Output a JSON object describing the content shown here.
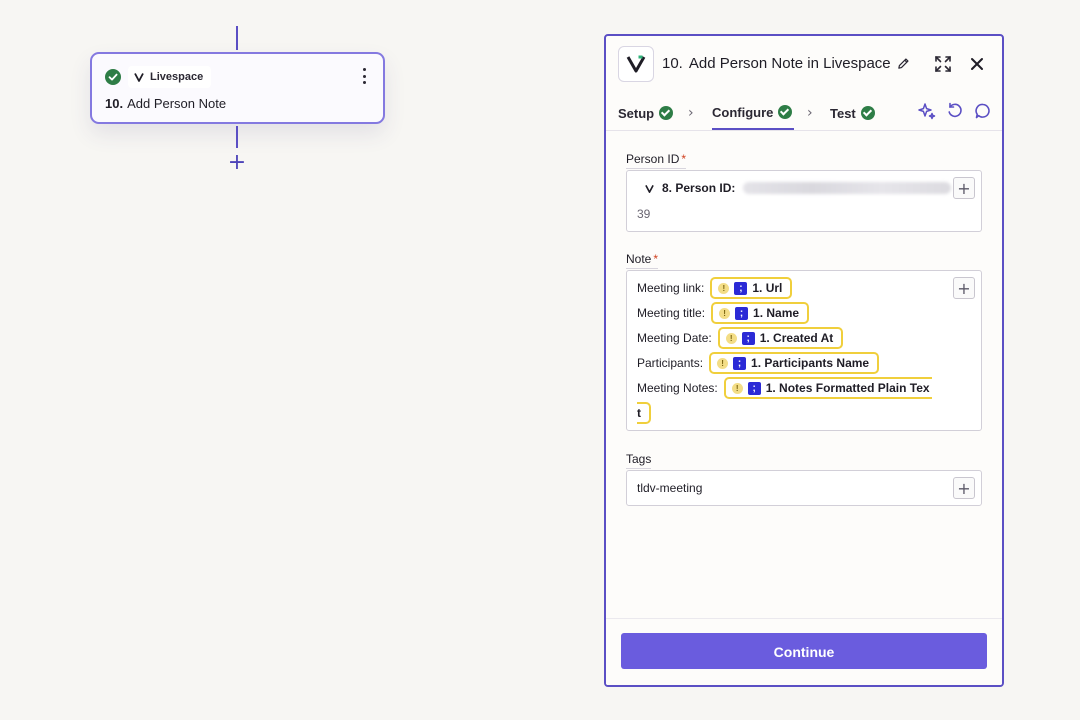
{
  "canvas": {
    "node": {
      "app_name": "Livespace",
      "step_number": "10.",
      "step_title": "Add Person Note"
    },
    "add_step_symbol": "+"
  },
  "panel": {
    "title_number": "10.",
    "title_text": "Add Person Note in Livespace",
    "tabs": [
      {
        "label": "Setup",
        "status": "complete"
      },
      {
        "label": "Configure",
        "status": "complete",
        "active": true
      },
      {
        "label": "Test",
        "status": "complete"
      }
    ],
    "fields": {
      "person_id": {
        "label": "Person ID",
        "required_mark": "*",
        "token_label": "8. Person ID:",
        "extra_value": "39"
      },
      "note": {
        "label": "Note",
        "required_mark": "*",
        "lines": [
          {
            "prefix": "Meeting link:",
            "token": "1. Url"
          },
          {
            "prefix": "Meeting title:",
            "token": "1. Name"
          },
          {
            "prefix": "Meeting Date:",
            "token": "1. Created At"
          },
          {
            "prefix": "Participants:",
            "token": "1. Participants Name"
          },
          {
            "prefix": "Meeting Notes:",
            "token": "1. Notes Formatted Plain Tex"
          }
        ],
        "wrap_tail": "t"
      },
      "tags": {
        "label": "Tags",
        "value": "tldv-meeting"
      }
    },
    "plus_symbol": "+",
    "continue_label": "Continue"
  },
  "colors": {
    "accent": "#5b4fc4",
    "button": "#6a5cde",
    "success": "#2e7d46",
    "warning_border": "#f0cf3c",
    "tldv_brand": "#2b2ad6",
    "required": "#d0401f"
  },
  "icons": [
    "check-circle-icon",
    "livespace-logo-icon",
    "kebab-menu-icon",
    "pencil-icon",
    "expand-icon",
    "close-icon",
    "chevron-right-icon",
    "sparkle-icon",
    "undo-icon",
    "comment-icon",
    "plus-icon",
    "warning-icon",
    "tldv-icon"
  ]
}
